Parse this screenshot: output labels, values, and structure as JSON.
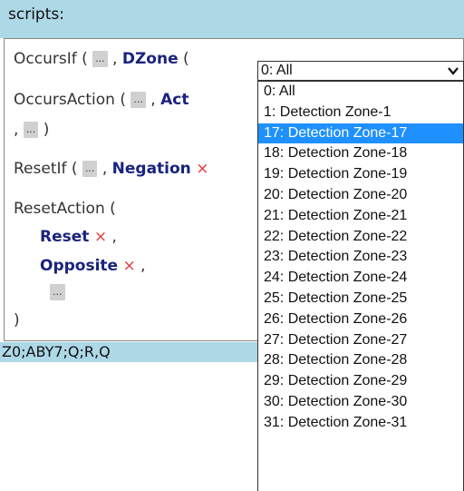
{
  "header": {
    "title": "scripts:"
  },
  "script": {
    "occurs_if": {
      "func": "OccursIf (",
      "slot1": "...",
      "sep1": ",",
      "kw": "DZone",
      "open": "(",
      "arg": "0",
      "close": ")",
      "x": "×"
    },
    "occurs_action": {
      "func": "OccursAction (",
      "slot1": "...",
      "sep1": ",",
      "kw": "Act",
      "sep2": ",",
      "slot2": "...",
      "close": ")"
    },
    "reset_if": {
      "func": "ResetIf (",
      "slot1": "...",
      "sep1": ",",
      "kw": "Negation",
      "x": "×"
    },
    "reset_action": {
      "func": "ResetAction (",
      "reset_kw": "Reset",
      "reset_x": "×",
      "reset_sep": ",",
      "opposite_kw": "Opposite",
      "opposite_x": "×",
      "opposite_sep": ",",
      "slot": "...",
      "close": ")"
    }
  },
  "footer": {
    "text": "Z0;ABY7;Q;R,Q"
  },
  "select": {
    "value": "0: All",
    "options": [
      "0: All",
      "1: Detection Zone-1",
      "17: Detection Zone-17",
      "18: Detection Zone-18",
      "19: Detection Zone-19",
      "20: Detection Zone-20",
      "21: Detection Zone-21",
      "22: Detection Zone-22",
      "23: Detection Zone-23",
      "24: Detection Zone-24",
      "25: Detection Zone-25",
      "26: Detection Zone-26",
      "27: Detection Zone-27",
      "28: Detection Zone-28",
      "29: Detection Zone-29",
      "30: Detection Zone-30",
      "31: Detection Zone-31"
    ],
    "highlighted_option": "17: Detection Zone-17"
  }
}
